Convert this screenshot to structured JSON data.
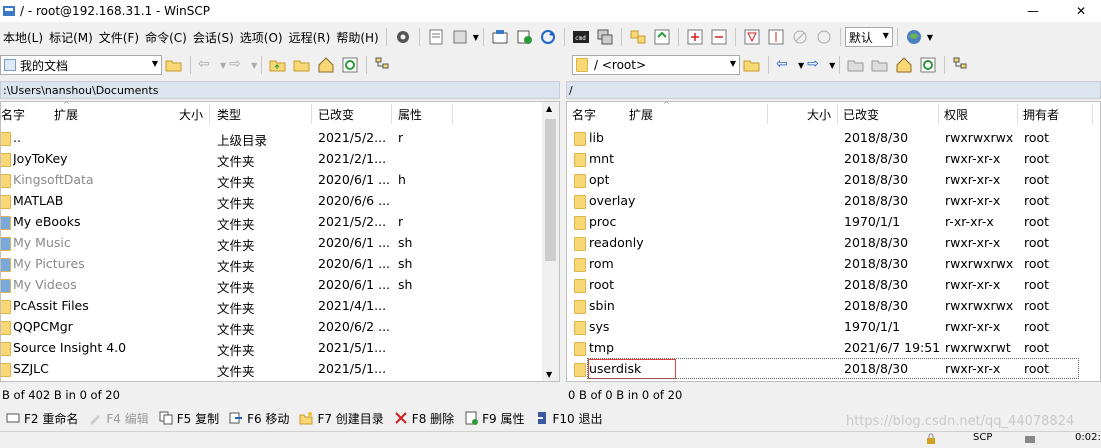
{
  "window": {
    "title": "/ - root@192.168.31.1 - WinSCP",
    "minimize_glyph": "—",
    "close_glyph": "✕"
  },
  "menu": [
    "本地(L)",
    "标记(M)",
    "文件(F)",
    "命令(C)",
    "会话(S)",
    "选项(O)",
    "远程(R)",
    "帮助(H)"
  ],
  "toolbar": {
    "transfer_setting": "默认"
  },
  "left": {
    "location": "我的文档",
    "path": ":\\Users\\nanshou\\Documents",
    "columns": [
      "名字",
      "扩展",
      "大小",
      "类型",
      "已改变",
      "属性"
    ],
    "files": [
      {
        "name": "..",
        "size": "",
        "type": "上级目录",
        "changed": "2021/5/2...",
        "attr": "r",
        "icon": "up-dir-icon",
        "muted": false
      },
      {
        "name": "JoyToKey",
        "size": "",
        "type": "文件夹",
        "changed": "2021/2/1...",
        "attr": "",
        "icon": "folder-icon",
        "muted": false
      },
      {
        "name": "KingsoftData",
        "size": "",
        "type": "文件夹",
        "changed": "2020/6/1 ...",
        "attr": "h",
        "icon": "folder-icon",
        "muted": true
      },
      {
        "name": "MATLAB",
        "size": "",
        "type": "文件夹",
        "changed": "2020/6/6 ...",
        "attr": "",
        "icon": "folder-icon",
        "muted": false
      },
      {
        "name": "My eBooks",
        "size": "",
        "type": "文件夹",
        "changed": "2021/5/2...",
        "attr": "r",
        "icon": "ebooks-icon",
        "muted": false
      },
      {
        "name": "My Music",
        "size": "",
        "type": "文件夹",
        "changed": "2020/6/1 ...",
        "attr": "sh",
        "icon": "music-icon",
        "muted": true
      },
      {
        "name": "My Pictures",
        "size": "",
        "type": "文件夹",
        "changed": "2020/6/1 ...",
        "attr": "sh",
        "icon": "pictures-icon",
        "muted": true
      },
      {
        "name": "My Videos",
        "size": "",
        "type": "文件夹",
        "changed": "2020/6/1 ...",
        "attr": "sh",
        "icon": "videos-icon",
        "muted": true
      },
      {
        "name": "PcAssit Files",
        "size": "",
        "type": "文件夹",
        "changed": "2021/4/1...",
        "attr": "",
        "icon": "folder-icon",
        "muted": false
      },
      {
        "name": "QQPCMgr",
        "size": "",
        "type": "文件夹",
        "changed": "2020/6/2 ...",
        "attr": "",
        "icon": "folder-icon",
        "muted": false
      },
      {
        "name": "Source Insight 4.0",
        "size": "",
        "type": "文件夹",
        "changed": "2021/5/1...",
        "attr": "",
        "icon": "folder-icon",
        "muted": false
      },
      {
        "name": "SZJLC",
        "size": "",
        "type": "文件夹",
        "changed": "2021/5/1...",
        "attr": "",
        "icon": "folder-icon",
        "muted": false
      }
    ],
    "status": "B of 402 B in 0 of 20"
  },
  "right": {
    "location": "/ <root>",
    "path": "/",
    "columns": [
      "名字",
      "扩展",
      "大小",
      "已改变",
      "权限",
      "拥有者"
    ],
    "files": [
      {
        "name": "lib",
        "changed": "2018/8/30",
        "rights": "rwxrwxrwx",
        "owner": "root"
      },
      {
        "name": "mnt",
        "changed": "2018/8/30",
        "rights": "rwxr-xr-x",
        "owner": "root"
      },
      {
        "name": "opt",
        "changed": "2018/8/30",
        "rights": "rwxr-xr-x",
        "owner": "root"
      },
      {
        "name": "overlay",
        "changed": "2018/8/30",
        "rights": "rwxr-xr-x",
        "owner": "root"
      },
      {
        "name": "proc",
        "changed": "1970/1/1",
        "rights": "r-xr-xr-x",
        "owner": "root"
      },
      {
        "name": "readonly",
        "changed": "2018/8/30",
        "rights": "rwxr-xr-x",
        "owner": "root"
      },
      {
        "name": "rom",
        "changed": "2018/8/30",
        "rights": "rwxrwxrwx",
        "owner": "root"
      },
      {
        "name": "root",
        "changed": "2018/8/30",
        "rights": "rwxr-xr-x",
        "owner": "root"
      },
      {
        "name": "sbin",
        "changed": "2018/8/30",
        "rights": "rwxrwxrwx",
        "owner": "root"
      },
      {
        "name": "sys",
        "changed": "1970/1/1",
        "rights": "rwxr-xr-x",
        "owner": "root"
      },
      {
        "name": "tmp",
        "changed": "2021/6/7 19:51",
        "rights": "rwxrwxrwt",
        "owner": "root"
      },
      {
        "name": "userdisk",
        "changed": "2018/8/30",
        "rights": "rwxr-xr-x",
        "owner": "root"
      }
    ],
    "status": "0 B of 0 B in 0 of 20"
  },
  "fkeys": [
    {
      "label": "F2 重命名",
      "icon": "rename-icon",
      "disabled": false
    },
    {
      "label": "F4 编辑",
      "icon": "edit-icon",
      "disabled": true
    },
    {
      "label": "F5 复制",
      "icon": "copy-icon",
      "disabled": false
    },
    {
      "label": "F6 移动",
      "icon": "move-icon",
      "disabled": false
    },
    {
      "label": "F7 创建目录",
      "icon": "create-dir-icon",
      "disabled": false
    },
    {
      "label": "F8 删除",
      "icon": "delete-icon",
      "disabled": false
    },
    {
      "label": "F9 属性",
      "icon": "properties-icon",
      "disabled": false
    },
    {
      "label": "F10 退出",
      "icon": "exit-icon",
      "disabled": false
    }
  ],
  "bottom": {
    "protocol": "SCP",
    "time": "0:02:"
  },
  "watermark": "https://blog.csdn.net/qq_44078824",
  "colors": {
    "accent": "#1e64c8",
    "selection_outline": "#e04040",
    "folder": "#f8d775"
  }
}
